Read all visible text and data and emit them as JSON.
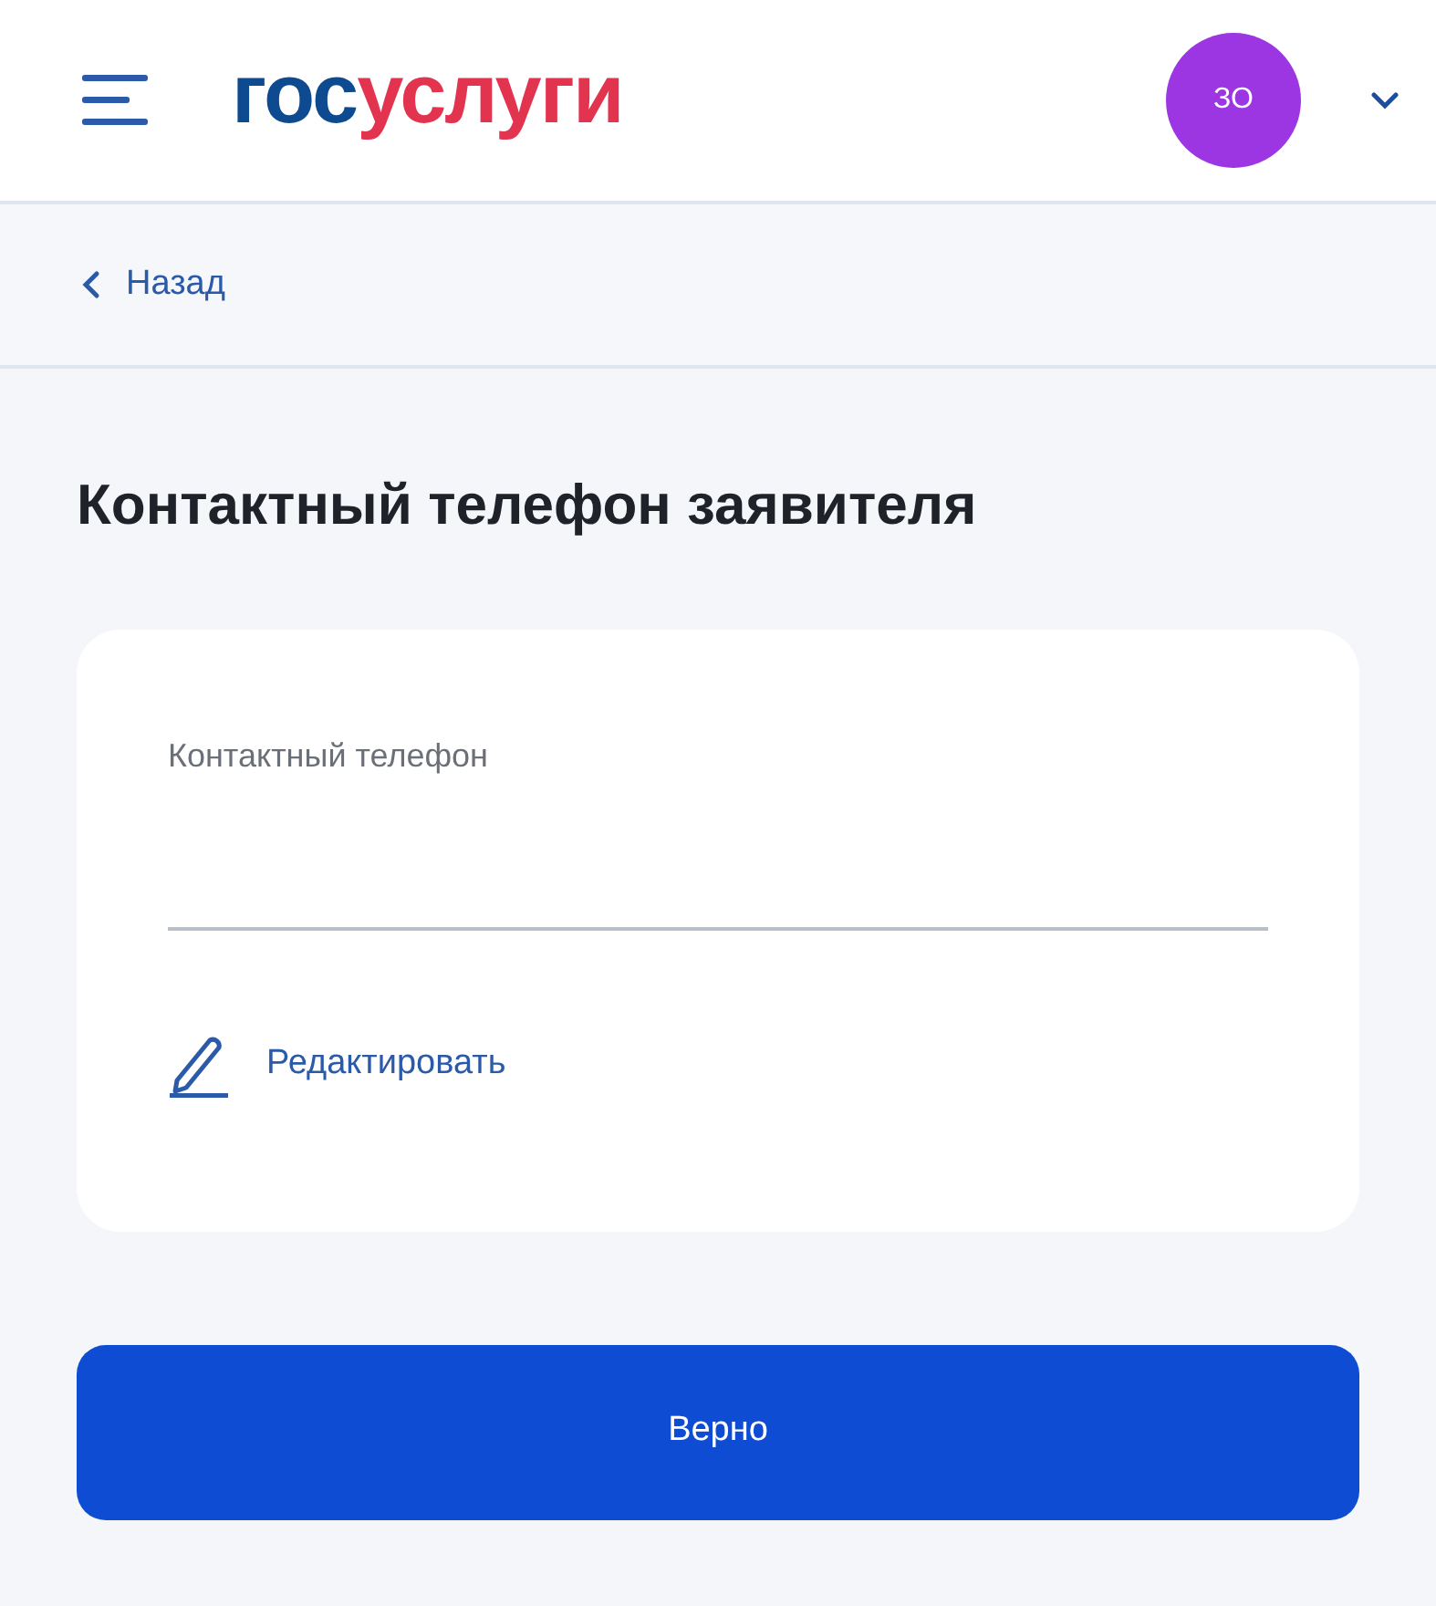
{
  "header": {
    "logo_parts": [
      {
        "text": "гос",
        "color": "#0d4a8f"
      },
      {
        "text": "услуги",
        "color": "#e3344f"
      }
    ],
    "avatar": "ЗО"
  },
  "back_link": "Назад",
  "title": "Контактный телефон заявителя",
  "card": {
    "field_label": "Контактный телефон",
    "edit_link": "Редактировать"
  },
  "submit_button": "Верно"
}
